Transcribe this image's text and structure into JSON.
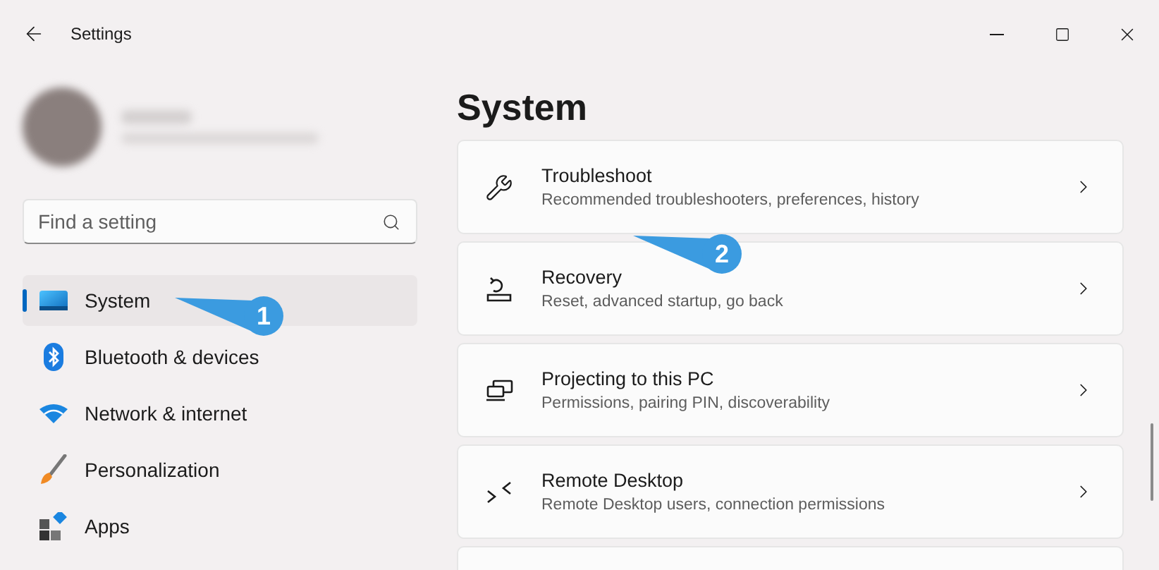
{
  "window": {
    "title": "Settings"
  },
  "search": {
    "placeholder": "Find a setting"
  },
  "nav": [
    {
      "label": "System",
      "selected": true,
      "callout": "1"
    },
    {
      "label": "Bluetooth & devices",
      "selected": false
    },
    {
      "label": "Network & internet",
      "selected": false
    },
    {
      "label": "Personalization",
      "selected": false
    },
    {
      "label": "Apps",
      "selected": false
    }
  ],
  "page_title": "System",
  "cards": [
    {
      "title": "Troubleshoot",
      "subtitle": "Recommended troubleshooters, preferences, history"
    },
    {
      "title": "Recovery",
      "subtitle": "Reset, advanced startup, go back",
      "callout": "2"
    },
    {
      "title": "Projecting to this PC",
      "subtitle": "Permissions, pairing PIN, discoverability"
    },
    {
      "title": "Remote Desktop",
      "subtitle": "Remote Desktop users, connection permissions"
    }
  ]
}
